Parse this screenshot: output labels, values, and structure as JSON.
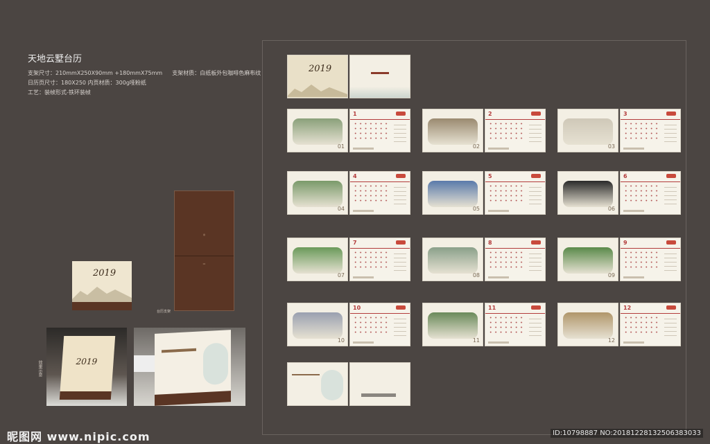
{
  "spec": {
    "title": "天地云墅台历",
    "line1_a": "支架尺寸：210mmX250X90mm +180mmX75mm",
    "line1_b": "支架材质：白纸板外包咖啡色麻布纹",
    "line2": "日历页尺寸：180X250    内页材质：300g哑粉纸",
    "line3": "工艺：装帧形式-铁环装帧"
  },
  "stand_label": "台历支架",
  "effect_label": "效果示意",
  "cover": {
    "year": "2019"
  },
  "months": [
    {
      "photo": "01",
      "cal": "1",
      "cap": "天地云墅"
    },
    {
      "photo": "02",
      "cal": "2",
      "cap": "天地云墅"
    },
    {
      "photo": "03",
      "cal": "3",
      "cap": "天地云墅"
    },
    {
      "photo": "04",
      "cal": "4",
      "cap": "天地云墅"
    },
    {
      "photo": "05",
      "cal": "5",
      "cap": "天地云墅"
    },
    {
      "photo": "06",
      "cal": "6",
      "cap": "天地云墅"
    },
    {
      "photo": "07",
      "cal": "7",
      "cap": "天地云墅"
    },
    {
      "photo": "08",
      "cal": "8",
      "cap": "天地云墅"
    },
    {
      "photo": "09",
      "cal": "9",
      "cap": "天地云墅"
    },
    {
      "photo": "10",
      "cal": "10",
      "cap": "天地云墅"
    },
    {
      "photo": "11",
      "cal": "11",
      "cap": "天地云墅"
    },
    {
      "photo": "12",
      "cal": "12",
      "cap": "天地云墅"
    }
  ],
  "watermark": {
    "site": "昵图网 www.nipic.com",
    "id": "ID:10798887 NO:20181228132506383033"
  },
  "colors": {
    "background": "#4b4542",
    "accent": "#b23a3a",
    "stand": "#5a3524",
    "paper": "#f3efe4"
  }
}
